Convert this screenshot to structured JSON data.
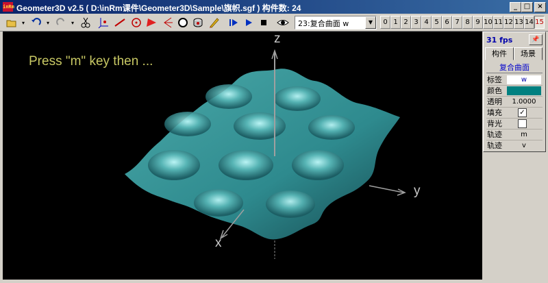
{
  "window": {
    "app_icon_text": "inRm",
    "title": "Geometer3D v2.5 ( D:\\inRm课件\\Geometer3D\\Sample\\旗帜.sgf ) 构件数: 24",
    "minimize": "_",
    "maximize": "□",
    "close": "×"
  },
  "toolbar": {
    "icons": [
      "open-icon",
      "undo-icon",
      "redo-icon",
      "cut-icon",
      "axes-icon",
      "line-icon",
      "circle-point-icon",
      "triangle-icon",
      "plane-icon",
      "sphere-icon",
      "solid-icon",
      "pen-icon",
      "step-play-icon",
      "play-icon",
      "stop-icon",
      "eye-icon"
    ],
    "object_select": "23:复合曲面  w",
    "layer_buttons": [
      "0",
      "1",
      "2",
      "3",
      "4",
      "5",
      "6",
      "7",
      "8",
      "9",
      "10",
      "11",
      "12",
      "13",
      "14",
      "15"
    ],
    "active_layer": "15"
  },
  "viewport": {
    "prompt": "Press \"m\" key then ...",
    "axis_z": "z",
    "axis_y": "y",
    "axis_x": "x",
    "surface_color": "#3a9c9c",
    "background": "#000000"
  },
  "panel": {
    "fps": "31 fps",
    "tabs": [
      "构件",
      "场景"
    ],
    "object_name": "复合曲面",
    "rows": [
      {
        "label": "标签",
        "value": "w"
      },
      {
        "label": "颜色",
        "value": ""
      },
      {
        "label": "透明",
        "value": "1.0000"
      },
      {
        "label": "填充",
        "checked": "✓"
      },
      {
        "label": "背光",
        "checked": ""
      },
      {
        "label": "轨迹",
        "value": "m"
      },
      {
        "label": "轨迹",
        "value": "v"
      }
    ],
    "color_swatch": "#008080"
  }
}
